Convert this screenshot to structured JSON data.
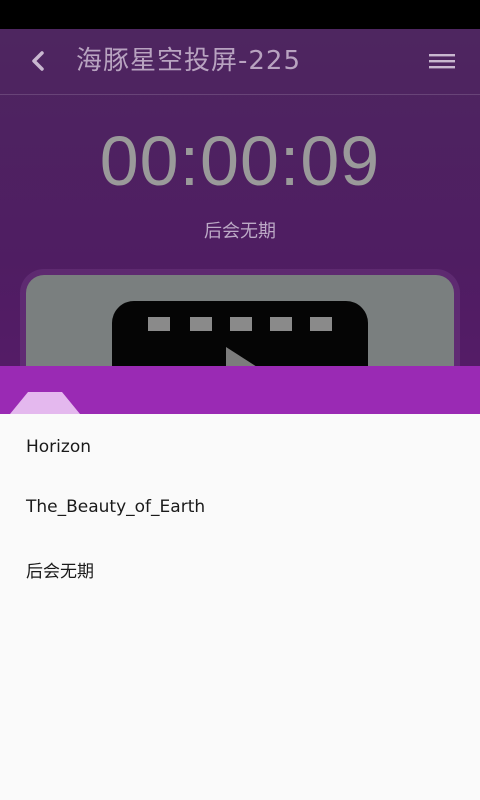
{
  "header": {
    "title": "海豚星空投屏-225"
  },
  "player": {
    "elapsed": "00:00:09",
    "current_track": "后会无期"
  },
  "playlist": {
    "items": [
      {
        "label": "Horizon"
      },
      {
        "label": "The_Beauty_of_Earth"
      },
      {
        "label": "后会无期"
      }
    ]
  },
  "colors": {
    "accent_purple": "#9a2ab4",
    "app_background": "#4f1d62",
    "sheet_background": "#fafafa"
  },
  "icons": {
    "back": "chevron-left-icon",
    "menu": "hamburger-menu-icon",
    "thumbnail": "film-play-icon"
  }
}
